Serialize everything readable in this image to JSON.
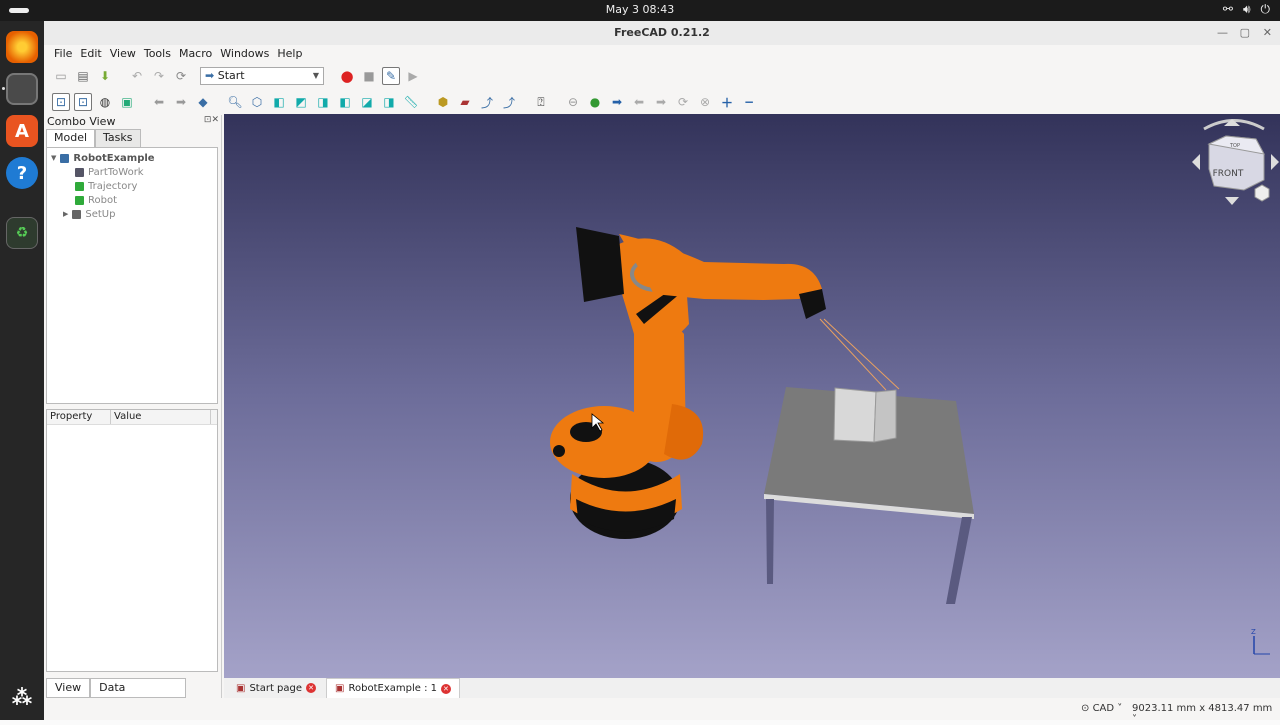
{
  "topbar": {
    "clock": "May 3  08:43",
    "tray_icons": [
      "network-icon",
      "volume-icon",
      "power-icon"
    ]
  },
  "dock": {
    "apps": [
      {
        "name": "firefox",
        "color": "#e66000"
      },
      {
        "name": "files",
        "color": "#555555"
      },
      {
        "name": "app-center",
        "color": "#e95420"
      },
      {
        "name": "help",
        "color": "#1f7bd4"
      },
      {
        "name": "trash",
        "color": "#2e7d32"
      }
    ]
  },
  "window": {
    "title": "FreeCAD 0.21.2"
  },
  "menu": [
    "File",
    "Edit",
    "View",
    "Tools",
    "Macro",
    "Windows",
    "Help"
  ],
  "workbench": {
    "selected": "Start"
  },
  "combo": {
    "title": "Combo View",
    "tabs": [
      "Model",
      "Tasks"
    ],
    "tree": {
      "root": "RobotExample",
      "children": [
        {
          "label": "PartToWork",
          "icon_color": "#555566"
        },
        {
          "label": "Trajectory",
          "icon_color": "#2faa3a"
        },
        {
          "label": "Robot",
          "icon_color": "#2faa3a"
        },
        {
          "label": "SetUp",
          "icon_color": "#666666"
        }
      ]
    },
    "property_headers": [
      "Property",
      "Value"
    ],
    "bottom_tabs": [
      "View",
      "Data"
    ]
  },
  "navcube": {
    "face": "FRONT",
    "top": "TOP"
  },
  "doc_tabs": [
    {
      "label": "Start page"
    },
    {
      "label": "RobotExample : 1"
    }
  ],
  "status": {
    "nav_style": "CAD",
    "dimensions": "9023.11 mm x 4813.47 mm"
  },
  "colors": {
    "robot": "#ee7a10",
    "table": "#7a7a7a",
    "legs": "#5a5a80",
    "background_top": "#33335a",
    "background_bottom": "#a4a2c8"
  }
}
